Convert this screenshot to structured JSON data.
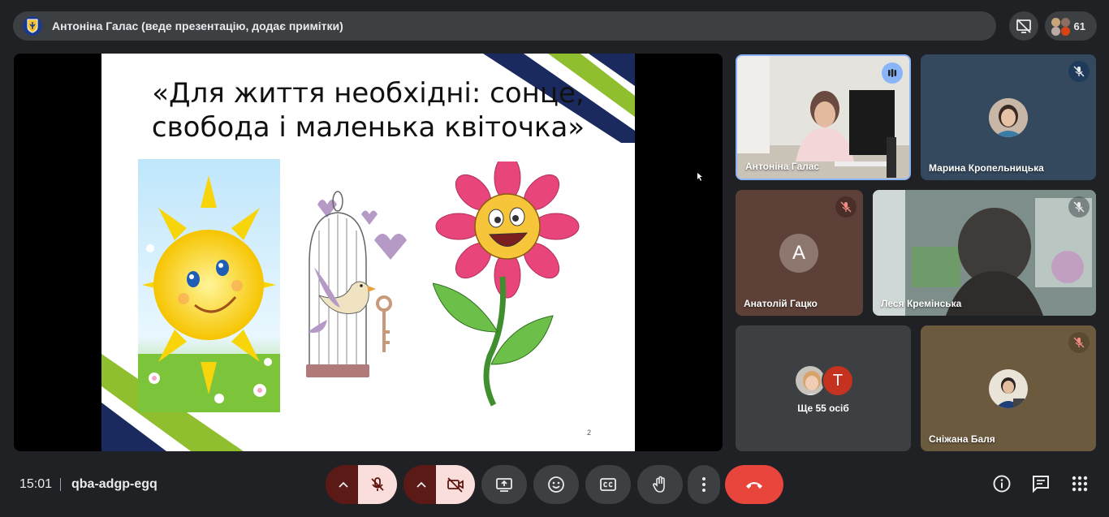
{
  "topbar": {
    "title": "Антоніна Галас (веде презентацію, додає примітки)",
    "people_count": "61"
  },
  "slide": {
    "title_line1": "«Для життя необхідні: сонце,",
    "title_line2": "свобода і маленька квіточка»",
    "page_number": "2"
  },
  "tiles": [
    {
      "name": "Антоніна Галас",
      "state": "speaking"
    },
    {
      "name": "Марина Кропельницька",
      "state": "muted"
    },
    {
      "name": "Анатолій Гацко",
      "state": "muted",
      "initial": "А"
    },
    {
      "name": "Леся Кремінська",
      "state": "muted"
    },
    {
      "name": "Ще 55 осіб",
      "initial": "Т"
    },
    {
      "name": "Сніжана Баля",
      "state": "muted"
    }
  ],
  "bottom": {
    "time": "15:01",
    "meeting_code": "qba-adgp-egq"
  },
  "colors": {
    "background": "#202124",
    "surface": "#3c4043",
    "hangup": "#e8453c",
    "muted_control": "#f9dedc",
    "accent": "#8ab4f8"
  },
  "icons": [
    "emblem-icon",
    "presentation-off-icon",
    "mic-off-icon",
    "camera-off-icon",
    "present-screen-icon",
    "emoji-icon",
    "captions-icon",
    "raise-hand-icon",
    "more-icon",
    "hangup-icon",
    "info-icon",
    "chat-icon",
    "apps-icon",
    "chevron-up-icon"
  ]
}
